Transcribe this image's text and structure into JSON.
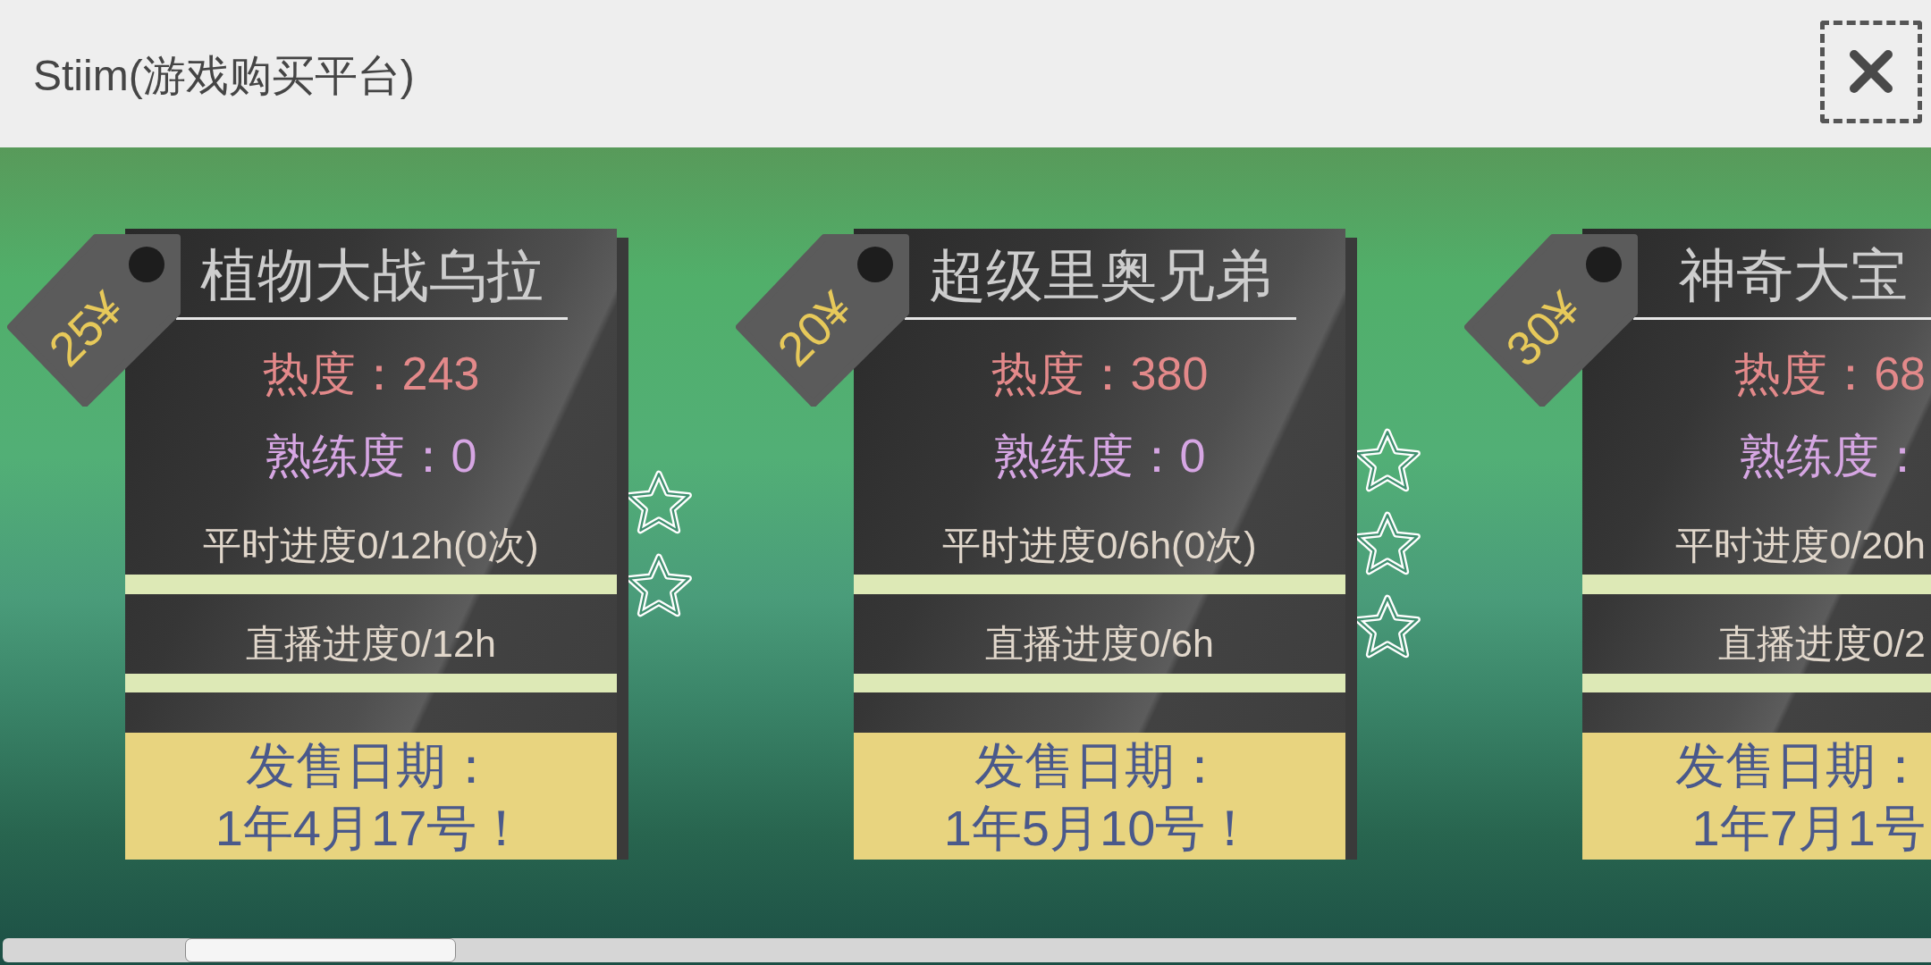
{
  "window": {
    "title": "Stiim(游戏购买平台)"
  },
  "games": [
    {
      "price": "25¥",
      "title": "植物大战乌拉",
      "heat": "热度：243",
      "proficiency": "熟练度：0",
      "progress": [
        "平时进度0/12h(0次)",
        "直播进度0/12h"
      ],
      "release": {
        "label": "发售日期：",
        "date": "1年4月17号！"
      },
      "star_marks": [
        {
          "kind": "star"
        },
        {
          "kind": "star"
        }
      ]
    },
    {
      "price": "20¥",
      "title": "超级里奥兄弟",
      "heat": "热度：380",
      "proficiency": "熟练度：0",
      "progress": [
        "平时进度0/6h(0次)",
        "直播进度0/6h"
      ],
      "release": {
        "label": "发售日期：",
        "date": "1年5月10号！"
      },
      "star_marks": [
        {
          "kind": "star"
        },
        {
          "kind": "star"
        },
        {
          "kind": "star"
        }
      ]
    },
    {
      "price": "30¥",
      "title": "神奇大宝",
      "heat": "热度：68",
      "proficiency": "熟练度：",
      "progress": [
        "平时进度0/20h",
        "直播进度0/2"
      ],
      "release": {
        "label": "发售日期：",
        "date": "1年7月1号"
      }
    }
  ]
}
